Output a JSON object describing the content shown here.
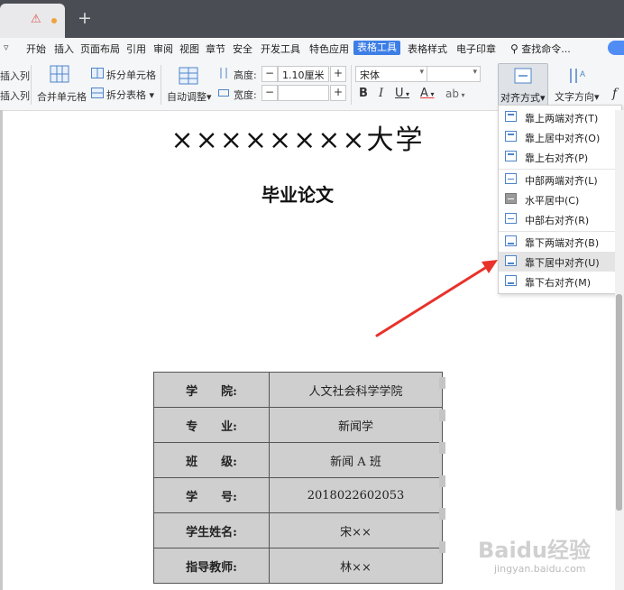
{
  "menubar": {
    "items": [
      "开始",
      "插入",
      "页面布局",
      "引用",
      "审阅",
      "视图",
      "章节",
      "安全",
      "开发工具",
      "特色应用",
      "表格工具",
      "表格样式",
      "电子印章"
    ],
    "active": "表格工具",
    "search_label": "查找命令..."
  },
  "ribbon": {
    "insert_row_1": "插入列",
    "insert_row_2": "插入列",
    "merge_cells": "合并单元格",
    "split_cells": "拆分单元格",
    "split_table": "拆分表格",
    "auto_adjust": "自动调整",
    "height_label": "高度:",
    "height_value": "1.10厘米",
    "width_label": "宽度:",
    "width_value": "",
    "font_name": "宋体",
    "font_size": "",
    "align_label": "对齐方式",
    "text_dir_label": "文字方向"
  },
  "align_menu": {
    "items": [
      "靠上两端对齐(T)",
      "靠上居中对齐(O)",
      "靠上右对齐(P)",
      "中部两端对齐(L)",
      "水平居中(C)",
      "中部右对齐(R)",
      "靠下两端对齐(B)",
      "靠下居中对齐(U)",
      "靠下右对齐(M)"
    ],
    "selected": "水平居中(C)",
    "highlighted": "靠下居中对齐(U)"
  },
  "document": {
    "title": "××××××××大学",
    "subtitle": "毕业论文",
    "table": [
      {
        "key": "学　　院:",
        "value": "人文社会科学学院"
      },
      {
        "key": "专　　业:",
        "value": "新闻学"
      },
      {
        "key": "班　　级:",
        "value": "新闻 A 班"
      },
      {
        "key": "学　　号:",
        "value": "2018022602053"
      },
      {
        "key": "学生姓名:",
        "value": "宋××"
      },
      {
        "key": "指导教师:",
        "value": "林××"
      }
    ]
  },
  "watermark": {
    "text": "Baidu经验",
    "sub": "jingyan.baidu.com"
  },
  "colors": {
    "accent": "#3d7ee6",
    "arrow": "#e8322b",
    "titlebar": "#4a4d54"
  }
}
